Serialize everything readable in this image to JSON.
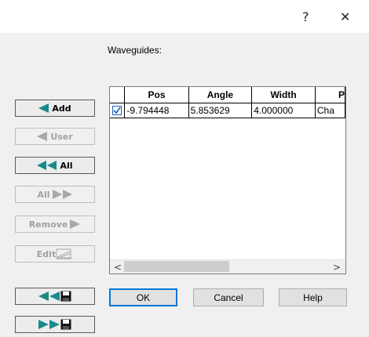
{
  "window": {
    "help_glyph": "?",
    "close_glyph": "✕"
  },
  "waveguides_label": "Waveguides:",
  "side_buttons": {
    "add": "Add",
    "user": "User",
    "all": "All",
    "all_right": "All",
    "remove": "Remove",
    "edit": "Edit"
  },
  "table": {
    "headers": [
      "Pos",
      "Angle",
      "Width",
      "P"
    ],
    "rows": [
      {
        "checked": true,
        "pos": "-9.794448",
        "angle": "5.853629",
        "width": "4.000000",
        "profile": "Cha"
      }
    ],
    "scroll_left": "<",
    "scroll_right": ">"
  },
  "dialog_buttons": {
    "ok": "OK",
    "cancel": "Cancel",
    "help": "Help"
  },
  "colors": {
    "arrow_teal": "#1a8a8a",
    "arrow_disabled": "#a8a8a8",
    "check_blue": "#1d5fb8",
    "focus_blue": "#0078d7"
  }
}
